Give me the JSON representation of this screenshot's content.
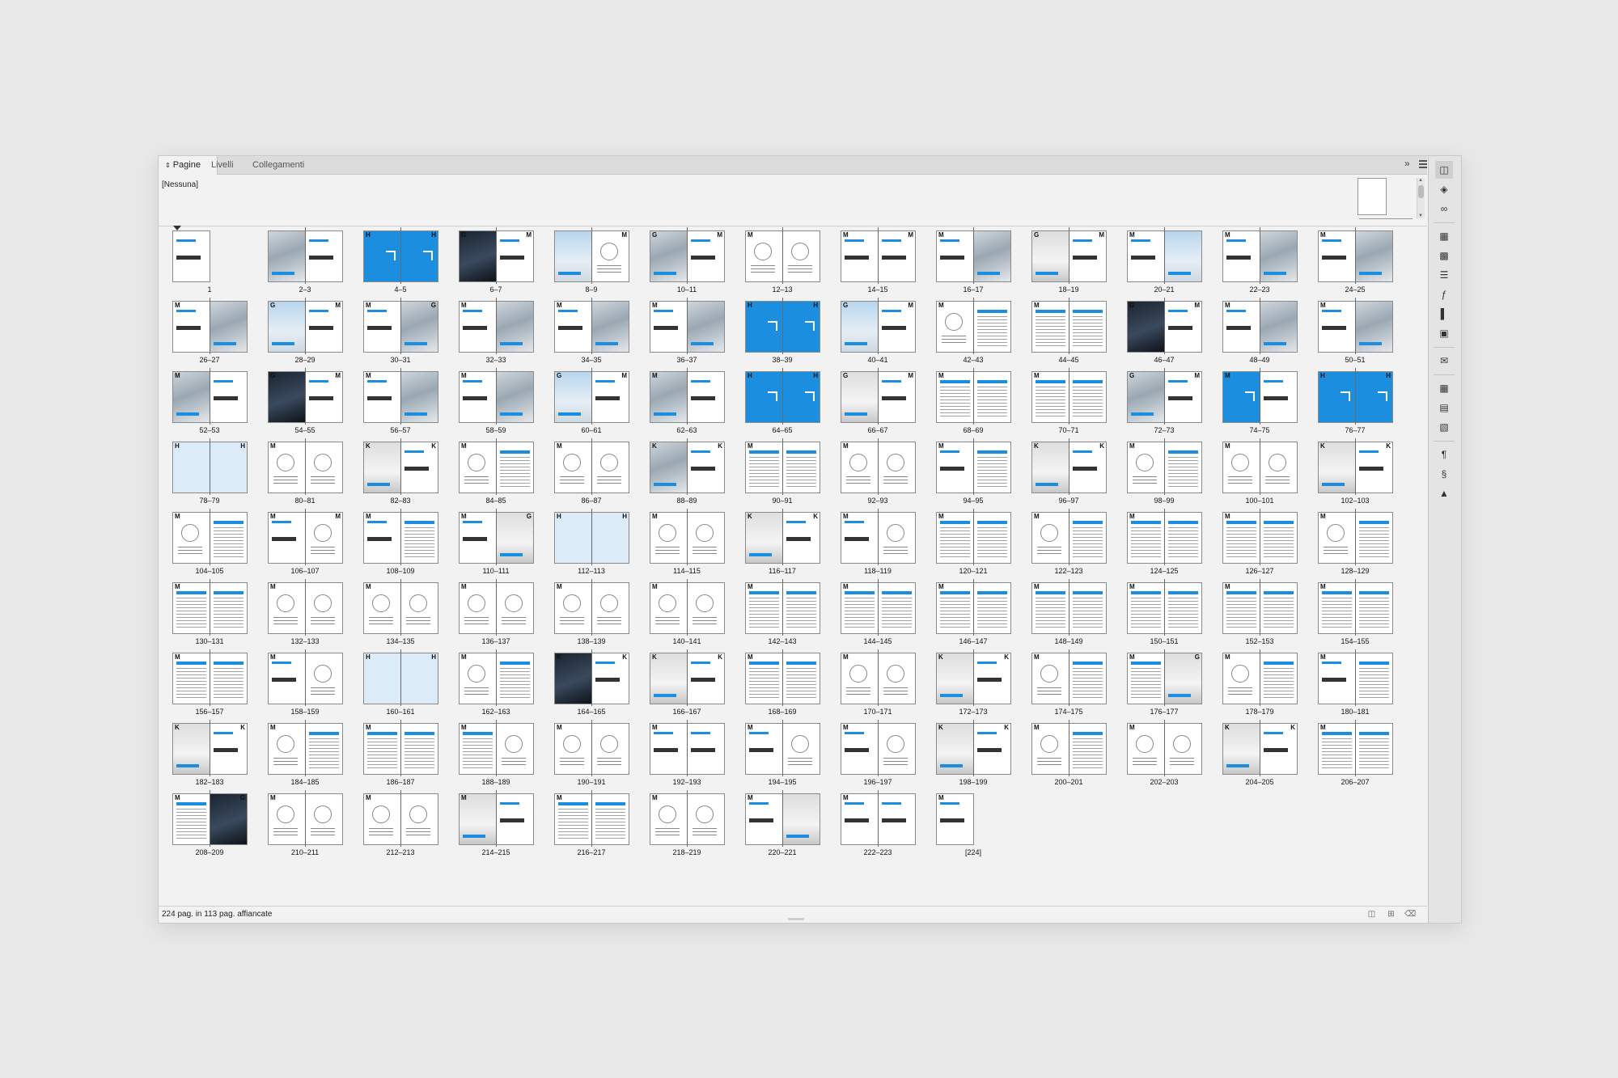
{
  "tabs": [
    {
      "label": "Pagine"
    },
    {
      "label": "Livelli"
    },
    {
      "label": "Collegamenti"
    }
  ],
  "master": {
    "none_label": "[Nessuna]"
  },
  "footer": {
    "summary": "224 pag. in 113 pag. affiancate"
  },
  "icons": {
    "tabs_collapse": "double-chevron-right-icon",
    "panel_menu": "panel-menu-icon",
    "footer": [
      "page-size-icon",
      "new-page-icon",
      "delete-page-icon"
    ],
    "sidebar": [
      "pages-icon",
      "layers-icon",
      "links-icon",
      "transform-icon",
      "wrap-icon",
      "stroke-icon",
      "effects-icon",
      "align-icon",
      "pathfinder-icon",
      "comment-icon",
      "table-icon",
      "cell-styles-icon",
      "table-styles-icon",
      "paragraph-styles-icon",
      "character-styles-icon",
      "object-styles-icon"
    ]
  },
  "colors": {
    "accent_blue": "#1b8ee0",
    "light_blue": "#dcebf8"
  },
  "spreads": [
    {
      "label": "1",
      "masters": [
        "",
        ""
      ],
      "types": [
        "",
        "text"
      ],
      "single": true
    },
    {
      "label": "2–3",
      "masters": [
        "",
        ""
      ],
      "types": [
        "photo",
        "text"
      ]
    },
    {
      "label": "4–5",
      "masters": [
        "H",
        "H"
      ],
      "types": [
        "blue",
        "blue"
      ]
    },
    {
      "label": "6–7",
      "masters": [
        "G",
        "M"
      ],
      "types": [
        "dark",
        "text"
      ]
    },
    {
      "label": "8–9",
      "masters": [
        "",
        "M"
      ],
      "types": [
        "sky",
        "diagram"
      ]
    },
    {
      "label": "10–11",
      "masters": [
        "G",
        "M"
      ],
      "types": [
        "photo",
        "text"
      ]
    },
    {
      "label": "12–13",
      "masters": [
        "M",
        ""
      ],
      "types": [
        "diagram",
        "diagram"
      ]
    },
    {
      "label": "14–15",
      "masters": [
        "M",
        "M"
      ],
      "types": [
        "text",
        "text"
      ]
    },
    {
      "label": "16–17",
      "masters": [
        "M",
        ""
      ],
      "types": [
        "text",
        "photo"
      ]
    },
    {
      "label": "18–19",
      "masters": [
        "G",
        "M"
      ],
      "types": [
        "gray",
        "text"
      ]
    },
    {
      "label": "20–21",
      "masters": [
        "M",
        ""
      ],
      "types": [
        "text",
        "sky"
      ]
    },
    {
      "label": "22–23",
      "masters": [
        "M",
        ""
      ],
      "types": [
        "text",
        "photo"
      ]
    },
    {
      "label": "24–25",
      "masters": [
        "M",
        ""
      ],
      "types": [
        "text",
        "photo"
      ]
    },
    {
      "label": "26–27",
      "masters": [
        "M",
        ""
      ],
      "types": [
        "text",
        "photo"
      ]
    },
    {
      "label": "28–29",
      "masters": [
        "G",
        "M"
      ],
      "types": [
        "sky",
        "text"
      ]
    },
    {
      "label": "30–31",
      "masters": [
        "M",
        "G"
      ],
      "types": [
        "text",
        "photo"
      ]
    },
    {
      "label": "32–33",
      "masters": [
        "M",
        ""
      ],
      "types": [
        "text",
        "photo"
      ]
    },
    {
      "label": "34–35",
      "masters": [
        "M",
        ""
      ],
      "types": [
        "text",
        "photo"
      ]
    },
    {
      "label": "36–37",
      "masters": [
        "M",
        ""
      ],
      "types": [
        "text",
        "photo"
      ]
    },
    {
      "label": "38–39",
      "masters": [
        "H",
        "H"
      ],
      "types": [
        "blue",
        "blue"
      ]
    },
    {
      "label": "40–41",
      "masters": [
        "G",
        "M"
      ],
      "types": [
        "sky",
        "text"
      ]
    },
    {
      "label": "42–43",
      "masters": [
        "M",
        ""
      ],
      "types": [
        "diagram",
        "table"
      ]
    },
    {
      "label": "44–45",
      "masters": [
        "M",
        ""
      ],
      "types": [
        "table",
        "table"
      ]
    },
    {
      "label": "46–47",
      "masters": [
        "G",
        "M"
      ],
      "types": [
        "dark",
        "text"
      ]
    },
    {
      "label": "48–49",
      "masters": [
        "M",
        ""
      ],
      "types": [
        "text",
        "photo"
      ]
    },
    {
      "label": "50–51",
      "masters": [
        "M",
        ""
      ],
      "types": [
        "text",
        "photo"
      ]
    },
    {
      "label": "52–53",
      "masters": [
        "M",
        ""
      ],
      "types": [
        "photo",
        "text"
      ]
    },
    {
      "label": "54–55",
      "masters": [
        "G",
        "M"
      ],
      "types": [
        "dark",
        "text"
      ]
    },
    {
      "label": "56–57",
      "masters": [
        "M",
        ""
      ],
      "types": [
        "text",
        "photo"
      ]
    },
    {
      "label": "58–59",
      "masters": [
        "M",
        ""
      ],
      "types": [
        "text",
        "photo"
      ]
    },
    {
      "label": "60–61",
      "masters": [
        "G",
        "M"
      ],
      "types": [
        "sky",
        "text"
      ]
    },
    {
      "label": "62–63",
      "masters": [
        "M",
        ""
      ],
      "types": [
        "photo",
        "text"
      ]
    },
    {
      "label": "64–65",
      "masters": [
        "H",
        "H"
      ],
      "types": [
        "blue",
        "blue"
      ]
    },
    {
      "label": "66–67",
      "masters": [
        "G",
        "M"
      ],
      "types": [
        "gray",
        "text"
      ]
    },
    {
      "label": "68–69",
      "masters": [
        "M",
        ""
      ],
      "types": [
        "table",
        "table"
      ]
    },
    {
      "label": "70–71",
      "masters": [
        "M",
        ""
      ],
      "types": [
        "table",
        "table"
      ]
    },
    {
      "label": "72–73",
      "masters": [
        "G",
        "M"
      ],
      "types": [
        "photo",
        "text"
      ]
    },
    {
      "label": "74–75",
      "masters": [
        "M",
        ""
      ],
      "types": [
        "blue",
        "text"
      ]
    },
    {
      "label": "76–77",
      "masters": [
        "H",
        "H"
      ],
      "types": [
        "blue",
        "blue"
      ]
    },
    {
      "label": "78–79",
      "masters": [
        "H",
        "H"
      ],
      "types": [
        "lightblue",
        "lightblue"
      ]
    },
    {
      "label": "80–81",
      "masters": [
        "M",
        ""
      ],
      "types": [
        "diagram",
        "diagram"
      ]
    },
    {
      "label": "82–83",
      "masters": [
        "K",
        "K"
      ],
      "types": [
        "gray",
        "text"
      ]
    },
    {
      "label": "84–85",
      "masters": [
        "M",
        ""
      ],
      "types": [
        "diagram",
        "table"
      ]
    },
    {
      "label": "86–87",
      "masters": [
        "M",
        ""
      ],
      "types": [
        "diagram",
        "diagram"
      ]
    },
    {
      "label": "88–89",
      "masters": [
        "K",
        "K"
      ],
      "types": [
        "photo",
        "text"
      ]
    },
    {
      "label": "90–91",
      "masters": [
        "M",
        ""
      ],
      "types": [
        "table",
        "table"
      ]
    },
    {
      "label": "92–93",
      "masters": [
        "M",
        ""
      ],
      "types": [
        "diagram",
        "diagram"
      ]
    },
    {
      "label": "94–95",
      "masters": [
        "M",
        ""
      ],
      "types": [
        "text",
        "table"
      ]
    },
    {
      "label": "96–97",
      "masters": [
        "K",
        "K"
      ],
      "types": [
        "gray",
        "text"
      ]
    },
    {
      "label": "98–99",
      "masters": [
        "M",
        ""
      ],
      "types": [
        "diagram",
        "table"
      ]
    },
    {
      "label": "100–101",
      "masters": [
        "M",
        ""
      ],
      "types": [
        "diagram",
        "diagram"
      ]
    },
    {
      "label": "102–103",
      "masters": [
        "K",
        "K"
      ],
      "types": [
        "gray",
        "text"
      ]
    },
    {
      "label": "104–105",
      "masters": [
        "M",
        ""
      ],
      "types": [
        "diagram",
        "table"
      ]
    },
    {
      "label": "106–107",
      "masters": [
        "M",
        "M"
      ],
      "types": [
        "text",
        "diagram"
      ]
    },
    {
      "label": "108–109",
      "masters": [
        "M",
        ""
      ],
      "types": [
        "text",
        "table"
      ]
    },
    {
      "label": "110–111",
      "masters": [
        "M",
        "G"
      ],
      "types": [
        "text",
        "gray"
      ]
    },
    {
      "label": "112–113",
      "masters": [
        "H",
        "H"
      ],
      "types": [
        "lightblue",
        "lightblue"
      ]
    },
    {
      "label": "114–115",
      "masters": [
        "M",
        ""
      ],
      "types": [
        "diagram",
        "diagram"
      ]
    },
    {
      "label": "116–117",
      "masters": [
        "K",
        "K"
      ],
      "types": [
        "gray",
        "text"
      ]
    },
    {
      "label": "118–119",
      "masters": [
        "M",
        ""
      ],
      "types": [
        "text",
        "diagram"
      ]
    },
    {
      "label": "120–121",
      "masters": [
        "M",
        ""
      ],
      "types": [
        "table",
        "table"
      ]
    },
    {
      "label": "122–123",
      "masters": [
        "M",
        ""
      ],
      "types": [
        "diagram",
        "table"
      ]
    },
    {
      "label": "124–125",
      "masters": [
        "M",
        ""
      ],
      "types": [
        "table",
        "table"
      ]
    },
    {
      "label": "126–127",
      "masters": [
        "M",
        ""
      ],
      "types": [
        "table",
        "table"
      ]
    },
    {
      "label": "128–129",
      "masters": [
        "M",
        ""
      ],
      "types": [
        "diagram",
        "table"
      ]
    },
    {
      "label": "130–131",
      "masters": [
        "M",
        ""
      ],
      "types": [
        "table",
        "table"
      ]
    },
    {
      "label": "132–133",
      "masters": [
        "M",
        ""
      ],
      "types": [
        "diagram",
        "diagram"
      ]
    },
    {
      "label": "134–135",
      "masters": [
        "M",
        ""
      ],
      "types": [
        "diagram",
        "diagram"
      ]
    },
    {
      "label": "136–137",
      "masters": [
        "M",
        ""
      ],
      "types": [
        "diagram",
        "diagram"
      ]
    },
    {
      "label": "138–139",
      "masters": [
        "M",
        ""
      ],
      "types": [
        "diagram",
        "diagram"
      ]
    },
    {
      "label": "140–141",
      "masters": [
        "M",
        ""
      ],
      "types": [
        "diagram",
        "diagram"
      ]
    },
    {
      "label": "142–143",
      "masters": [
        "M",
        ""
      ],
      "types": [
        "table",
        "table"
      ]
    },
    {
      "label": "144–145",
      "masters": [
        "M",
        ""
      ],
      "types": [
        "table",
        "table"
      ]
    },
    {
      "label": "146–147",
      "masters": [
        "M",
        ""
      ],
      "types": [
        "table",
        "table"
      ]
    },
    {
      "label": "148–149",
      "masters": [
        "M",
        ""
      ],
      "types": [
        "table",
        "table"
      ]
    },
    {
      "label": "150–151",
      "masters": [
        "M",
        ""
      ],
      "types": [
        "table",
        "table"
      ]
    },
    {
      "label": "152–153",
      "masters": [
        "M",
        ""
      ],
      "types": [
        "table",
        "table"
      ]
    },
    {
      "label": "154–155",
      "masters": [
        "M",
        ""
      ],
      "types": [
        "table",
        "table"
      ]
    },
    {
      "label": "156–157",
      "masters": [
        "M",
        ""
      ],
      "types": [
        "table",
        "table"
      ]
    },
    {
      "label": "158–159",
      "masters": [
        "M",
        ""
      ],
      "types": [
        "text",
        "diagram"
      ]
    },
    {
      "label": "160–161",
      "masters": [
        "H",
        "H"
      ],
      "types": [
        "lightblue",
        "lightblue"
      ]
    },
    {
      "label": "162–163",
      "masters": [
        "M",
        ""
      ],
      "types": [
        "diagram",
        "table"
      ]
    },
    {
      "label": "164–165",
      "masters": [
        "K",
        "K"
      ],
      "types": [
        "dark",
        "text"
      ]
    },
    {
      "label": "166–167",
      "masters": [
        "K",
        "K"
      ],
      "types": [
        "gray",
        "text"
      ]
    },
    {
      "label": "168–169",
      "masters": [
        "M",
        ""
      ],
      "types": [
        "table",
        "table"
      ]
    },
    {
      "label": "170–171",
      "masters": [
        "M",
        ""
      ],
      "types": [
        "diagram",
        "diagram"
      ]
    },
    {
      "label": "172–173",
      "masters": [
        "K",
        "K"
      ],
      "types": [
        "gray",
        "text"
      ]
    },
    {
      "label": "174–175",
      "masters": [
        "M",
        ""
      ],
      "types": [
        "diagram",
        "table"
      ]
    },
    {
      "label": "176–177",
      "masters": [
        "M",
        "G"
      ],
      "types": [
        "table",
        "gray"
      ]
    },
    {
      "label": "178–179",
      "masters": [
        "M",
        ""
      ],
      "types": [
        "diagram",
        "table"
      ]
    },
    {
      "label": "180–181",
      "masters": [
        "M",
        ""
      ],
      "types": [
        "text",
        "table"
      ]
    },
    {
      "label": "182–183",
      "masters": [
        "K",
        "K"
      ],
      "types": [
        "gray",
        "text"
      ]
    },
    {
      "label": "184–185",
      "masters": [
        "M",
        ""
      ],
      "types": [
        "diagram",
        "table"
      ]
    },
    {
      "label": "186–187",
      "masters": [
        "M",
        ""
      ],
      "types": [
        "table",
        "table"
      ]
    },
    {
      "label": "188–189",
      "masters": [
        "M",
        ""
      ],
      "types": [
        "table",
        "diagram"
      ]
    },
    {
      "label": "190–191",
      "masters": [
        "M",
        ""
      ],
      "types": [
        "diagram",
        "diagram"
      ]
    },
    {
      "label": "192–193",
      "masters": [
        "M",
        ""
      ],
      "types": [
        "text",
        "text"
      ]
    },
    {
      "label": "194–195",
      "masters": [
        "M",
        ""
      ],
      "types": [
        "text",
        "diagram"
      ]
    },
    {
      "label": "196–197",
      "masters": [
        "M",
        ""
      ],
      "types": [
        "text",
        "diagram"
      ]
    },
    {
      "label": "198–199",
      "masters": [
        "K",
        "K"
      ],
      "types": [
        "gray",
        "text"
      ]
    },
    {
      "label": "200–201",
      "masters": [
        "M",
        ""
      ],
      "types": [
        "diagram",
        "table"
      ]
    },
    {
      "label": "202–203",
      "masters": [
        "M",
        ""
      ],
      "types": [
        "diagram",
        "diagram"
      ]
    },
    {
      "label": "204–205",
      "masters": [
        "K",
        "K"
      ],
      "types": [
        "gray",
        "text"
      ]
    },
    {
      "label": "206–207",
      "masters": [
        "M",
        ""
      ],
      "types": [
        "table",
        "table"
      ]
    },
    {
      "label": "208–209",
      "masters": [
        "M",
        "G"
      ],
      "types": [
        "table",
        "dark"
      ]
    },
    {
      "label": "210–211",
      "masters": [
        "M",
        ""
      ],
      "types": [
        "diagram",
        "diagram"
      ]
    },
    {
      "label": "212–213",
      "masters": [
        "M",
        ""
      ],
      "types": [
        "diagram",
        "diagram"
      ]
    },
    {
      "label": "214–215",
      "masters": [
        "M",
        ""
      ],
      "types": [
        "gray",
        "text"
      ]
    },
    {
      "label": "216–217",
      "masters": [
        "M",
        ""
      ],
      "types": [
        "table",
        "table"
      ]
    },
    {
      "label": "218–219",
      "masters": [
        "M",
        ""
      ],
      "types": [
        "diagram",
        "diagram"
      ]
    },
    {
      "label": "220–221",
      "masters": [
        "M",
        ""
      ],
      "types": [
        "text",
        "gray"
      ]
    },
    {
      "label": "222–223",
      "masters": [
        "M",
        ""
      ],
      "types": [
        "text",
        "text"
      ]
    },
    {
      "label": "[224]",
      "masters": [
        "M",
        ""
      ],
      "types": [
        "text",
        ""
      ],
      "single": true,
      "single_left": true
    }
  ]
}
